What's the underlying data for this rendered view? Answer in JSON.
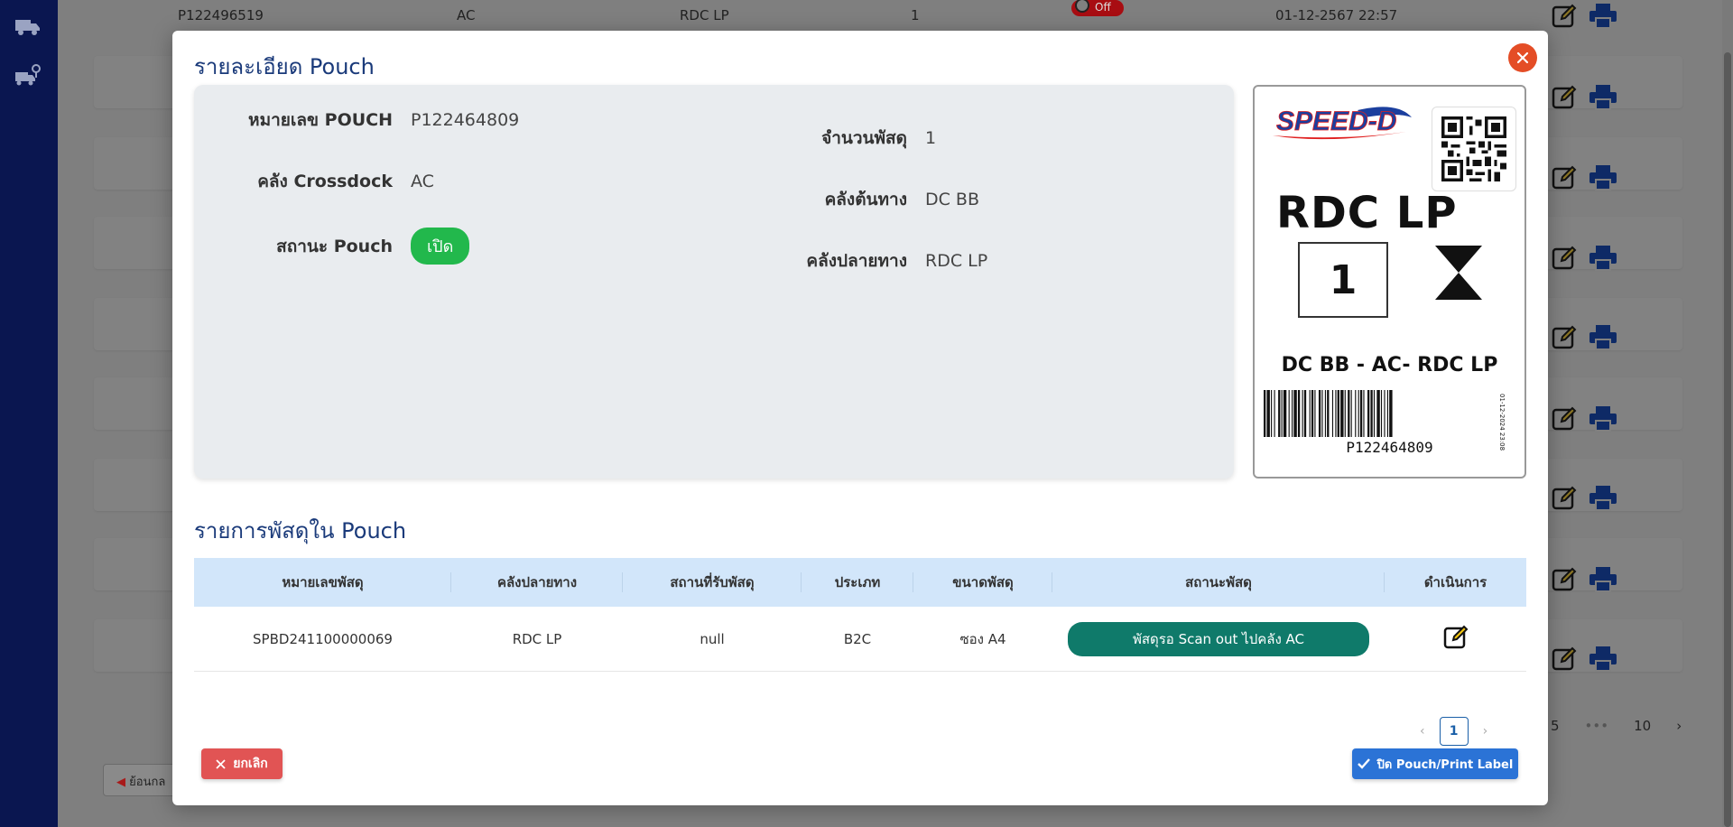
{
  "background": {
    "top_row": {
      "pouch_no": "P122496519",
      "crossdock": "AC",
      "destination": "RDC LP",
      "count": "1",
      "toggle_label": "Off",
      "datetime": "01-12-2567 22:57"
    },
    "pager": {
      "p5": "5",
      "ellipsis": "•••",
      "p10": "10",
      "next": "›"
    },
    "back_label": "ย้อนกล"
  },
  "modal": {
    "title": "รายละเอียด Pouch",
    "details": {
      "pouch_no_label": "หมายเลข POUCH",
      "pouch_no": "P122464809",
      "crossdock_label": "คลัง Crossdock",
      "crossdock": "AC",
      "status_label": "สถานะ Pouch",
      "status": "เปิด",
      "parcel_count_label": "จำนวนพัสดุ",
      "parcel_count": "1",
      "origin_label": "คลังต้นทาง",
      "origin": "DC BB",
      "destination_label": "คลังปลายทาง",
      "destination": "RDC LP"
    },
    "label": {
      "logo_text": "SPEED-D",
      "destination": "RDC LP",
      "count": "1",
      "route": "DC BB - AC- RDC LP",
      "code": "P122464809",
      "date": "01-12-2024 23:08"
    },
    "section_title": "รายการพัสดุใน Pouch",
    "table": {
      "headers": [
        "หมายเลขพัสดุ",
        "คลังปลายทาง",
        "สถานที่รับพัสดุ",
        "ประเภท",
        "ขนาดพัสดุ",
        "สถานะพัสดุ",
        "ดำเนินการ"
      ],
      "rows": [
        {
          "tracking": "SPBD241100000069",
          "destination": "RDC LP",
          "pickup": "null",
          "type": "B2C",
          "size": "ซอง A4",
          "status": "พัสดุรอ Scan out ไปคลัง AC"
        }
      ]
    },
    "pager": {
      "prev": "‹",
      "current": "1",
      "next": "›"
    },
    "cancel_label": "ยกเลิก",
    "print_label": "ปิด Pouch/Print Label"
  },
  "colors": {
    "accent": "#2b73d6",
    "danger": "#e15454",
    "status_open": "#22b84c",
    "parcel_status": "#0f7a6a",
    "title": "#1a3a7a"
  }
}
